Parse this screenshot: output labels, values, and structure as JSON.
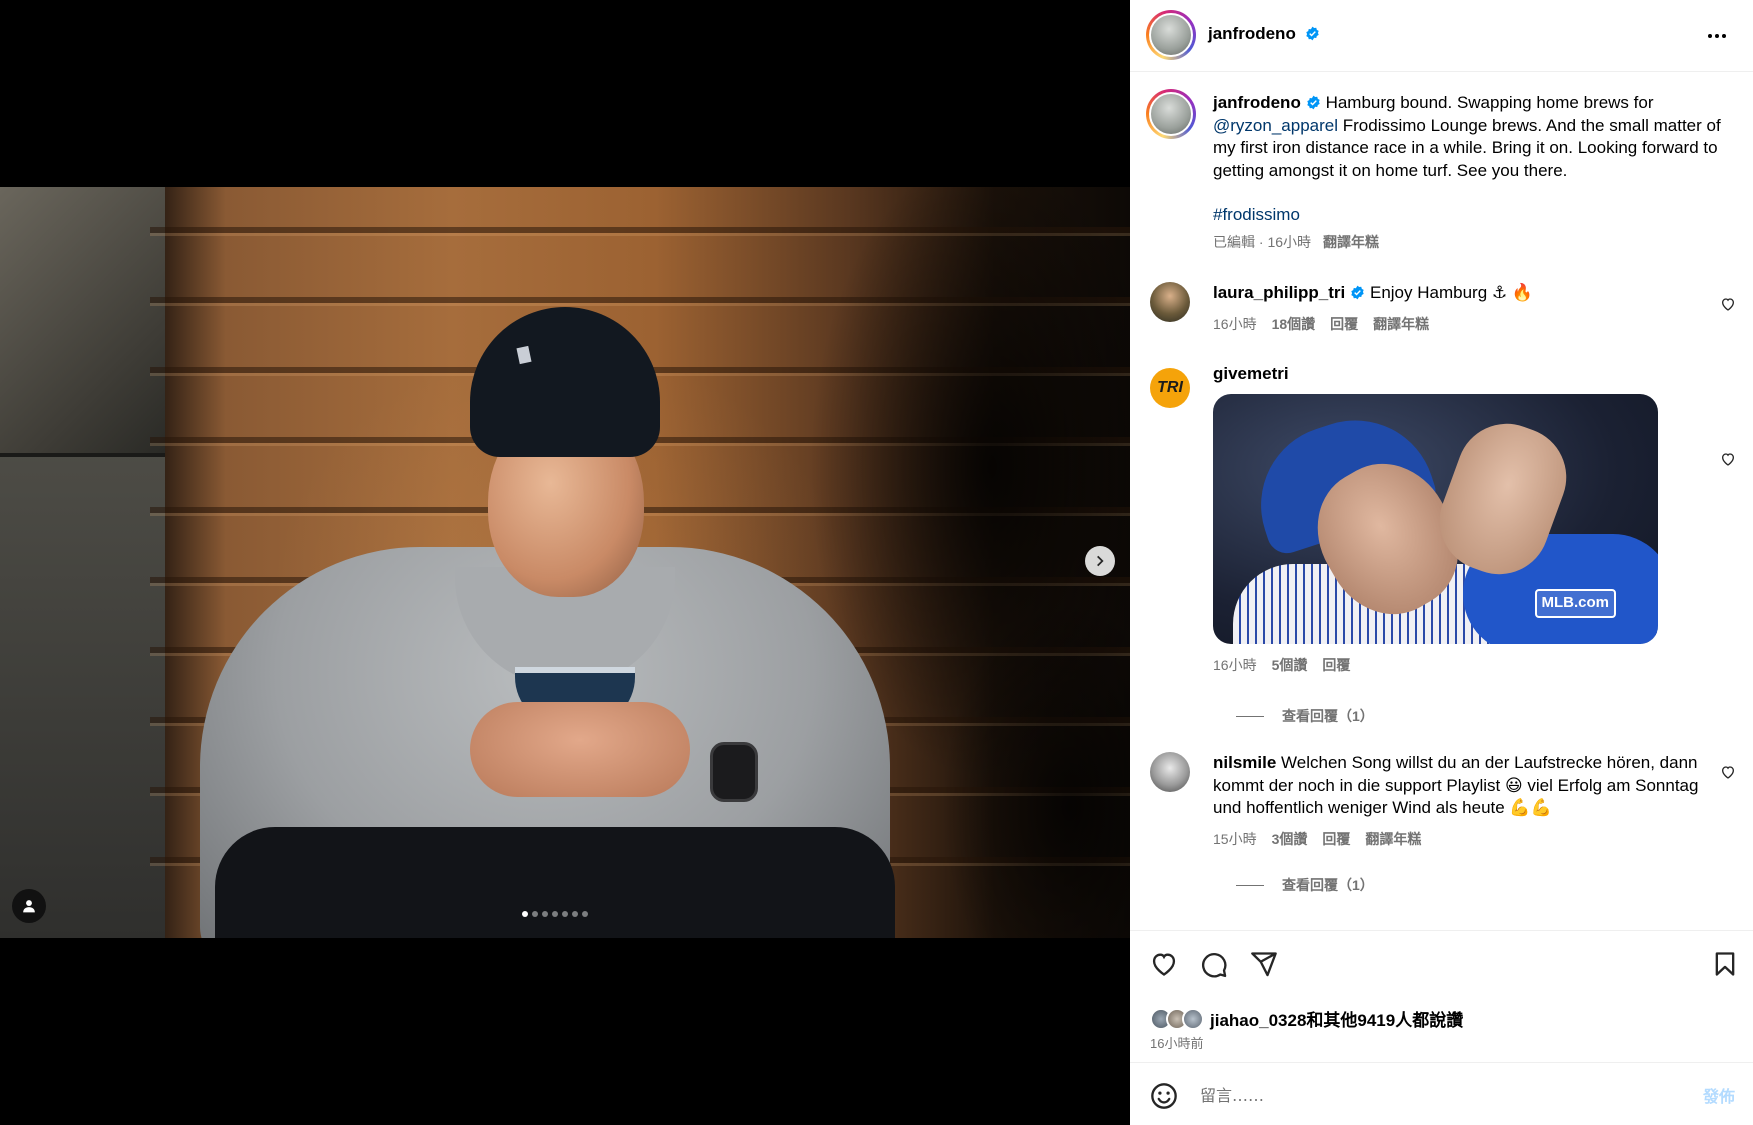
{
  "post": {
    "username": "janfrodeno",
    "verified": true,
    "caption": {
      "username": "janfrodeno",
      "text_before_mention": "Hamburg bound. Swapping home brews for",
      "mention": "@ryzon_apparel",
      "text_after_mention": "Frodissimo Lounge brews. And the small matter of my first iron distance race in a while. Bring it on. Looking forward to getting amongst it on home turf. See you there.",
      "hashtag": "#frodissimo",
      "meta_edited": "已編輯",
      "meta_time": "16小時",
      "meta_translate": "翻譯年糕"
    },
    "carousel": {
      "count": 7,
      "active_index": 0
    }
  },
  "comments": [
    {
      "username": "laura_philipp_tri",
      "verified": true,
      "text": "Enjoy Hamburg ⚓ 🔥",
      "time": "16小時",
      "likes": "18個讚",
      "reply": "回覆",
      "translate": "翻譯年糕"
    },
    {
      "username": "givemetri",
      "avatar_text": "TRI",
      "gif_watermark": "MLB.com",
      "time": "16小時",
      "likes": "5個讚",
      "reply": "回覆",
      "view_replies": "查看回覆（1）"
    },
    {
      "username": "nilsmile",
      "text": "Welchen Song willst du an der Laufstrecke hören, dann kommt der noch in die support Playlist 😃 viel Erfolg am Sonntag und hoffentlich weniger Wind als heute 💪💪",
      "time": "15小時",
      "likes": "3個讚",
      "reply": "回覆",
      "translate": "翻譯年糕",
      "view_replies": "查看回覆（1）"
    }
  ],
  "likes_summary": "jiahao_0328和其他9419人都說讚",
  "posted_ago": "16小時前",
  "comment_box": {
    "placeholder": "留言……",
    "post_label": "發佈"
  },
  "colors": {
    "link": "#00376b",
    "meta_gray": "#737373",
    "verified_blue": "#0095f6",
    "post_button_disabled": "#b3dbff"
  }
}
